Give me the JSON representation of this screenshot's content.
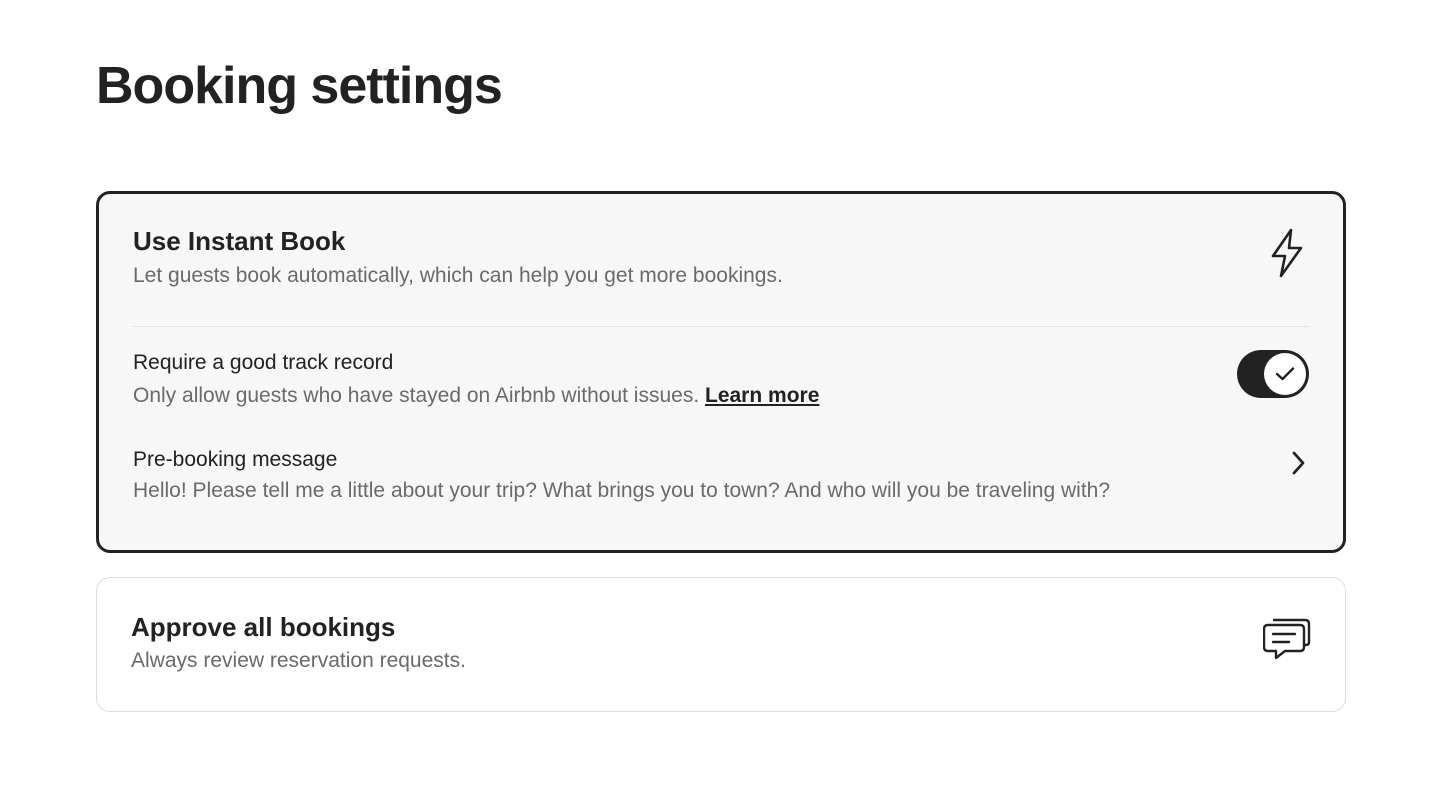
{
  "page": {
    "title": "Booking settings"
  },
  "instant_book": {
    "title": "Use Instant Book",
    "subtitle": "Let guests book automatically, which can help you get more bookings.",
    "icon": "lightning-bolt-icon",
    "selected": true,
    "track_record": {
      "title": "Require a good track record",
      "description": "Only allow guests who have stayed on Airbnb without issues.",
      "link_label": "Learn more",
      "enabled": true,
      "icon": "check-icon"
    },
    "pre_booking": {
      "title": "Pre-booking message",
      "message": "Hello! Please tell me a little about your trip? What brings you to town? And who will you be traveling with?",
      "icon": "chevron-right-icon"
    }
  },
  "approve_all": {
    "title": "Approve all bookings",
    "subtitle": "Always review reservation requests.",
    "icon": "chat-bubbles-icon",
    "selected": false
  },
  "colors": {
    "text_primary": "#222222",
    "text_secondary": "#6a6a6a",
    "selected_border": "#222222",
    "selected_background": "#f7f7f7",
    "card_border": "#dddddd",
    "toggle_on": "#222222"
  }
}
